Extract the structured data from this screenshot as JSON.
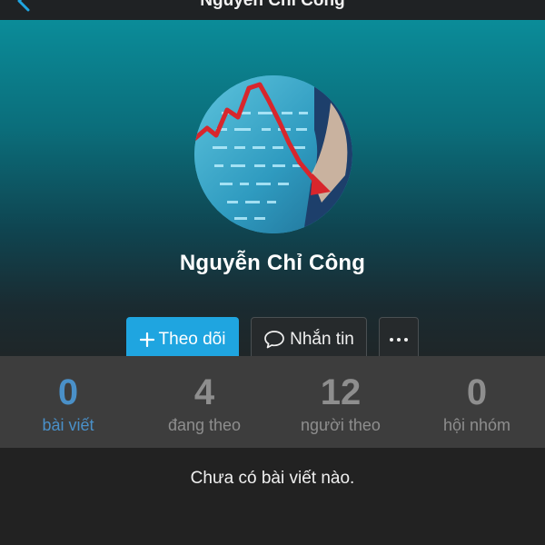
{
  "nav": {
    "title": "Nguyễn Chỉ Công",
    "back_icon": "chevron-left-icon"
  },
  "profile": {
    "name": "Nguyễn Chỉ Công",
    "avatar_icon": "stock-chart-down-icon"
  },
  "actions": {
    "follow_label": "Theo dõi",
    "message_label": "Nhắn tin",
    "more_icon": "ellipsis-icon"
  },
  "stats": [
    {
      "value": "0",
      "label": "bài viết"
    },
    {
      "value": "4",
      "label": "đang theo"
    },
    {
      "value": "12",
      "label": "người theo"
    },
    {
      "value": "0",
      "label": "hội nhóm"
    }
  ],
  "empty_message": "Chưa có bài viết nào.",
  "colors": {
    "accent": "#1fa5e0",
    "active_stat": "#4a90c8",
    "stat_bar": "#3d3d3d",
    "background": "#222222"
  }
}
